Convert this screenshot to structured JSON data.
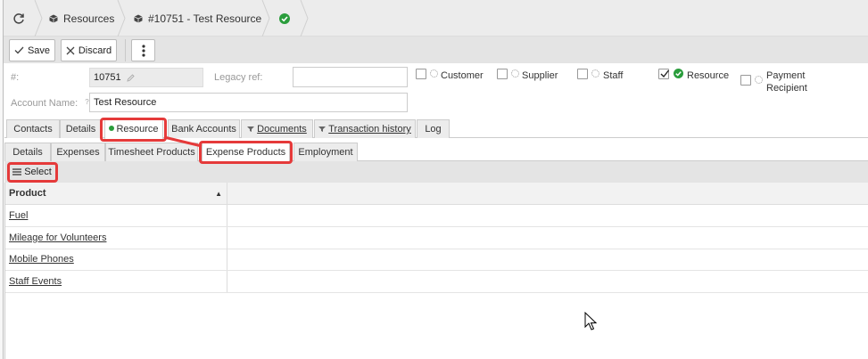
{
  "breadcrumb": {
    "resources_label": "Resources",
    "record_label": "#10751 - Test Resource"
  },
  "toolbar": {
    "save_label": "Save",
    "discard_label": "Discard"
  },
  "form": {
    "id_label": "#:",
    "id_value": "10751",
    "legacy_label": "Legacy ref:",
    "legacy_value": "",
    "account_label": "Account Name:",
    "account_help": "?",
    "account_value": "Test Resource",
    "roles": {
      "customer": {
        "label": "Customer",
        "checked": false
      },
      "supplier": {
        "label": "Supplier",
        "checked": false
      },
      "staff": {
        "label": "Staff",
        "checked": false
      },
      "resource": {
        "label": "Resource",
        "checked": true
      },
      "payment_line1": "Payment",
      "payment_line2": "Recipient"
    }
  },
  "tabs": {
    "contacts": "Contacts",
    "details": "Details",
    "resource": "Resource",
    "bank_accounts": "Bank Accounts",
    "documents": "Documents",
    "transaction_history": "Transaction history",
    "log": "Log"
  },
  "subtabs": {
    "details": "Details",
    "expenses": "Expenses",
    "timesheet_products": "Timesheet Products",
    "expense_products": "Expense Products",
    "employment": "Employment"
  },
  "grid": {
    "select_label": "Select",
    "column_product": "Product",
    "sort_indicator": "▲",
    "rows": [
      "Fuel",
      "Mileage for Volunteers",
      "Mobile Phones",
      "Staff Events"
    ]
  },
  "colors": {
    "highlight": "#e53a3a",
    "success_green": "#2a9d3c"
  },
  "icons": [
    "refresh-icon",
    "cube-icon",
    "check-circle-icon",
    "checkmark-icon",
    "close-icon",
    "vertical-dots-icon",
    "pencil-icon",
    "filter-icon",
    "menu-icon"
  ]
}
